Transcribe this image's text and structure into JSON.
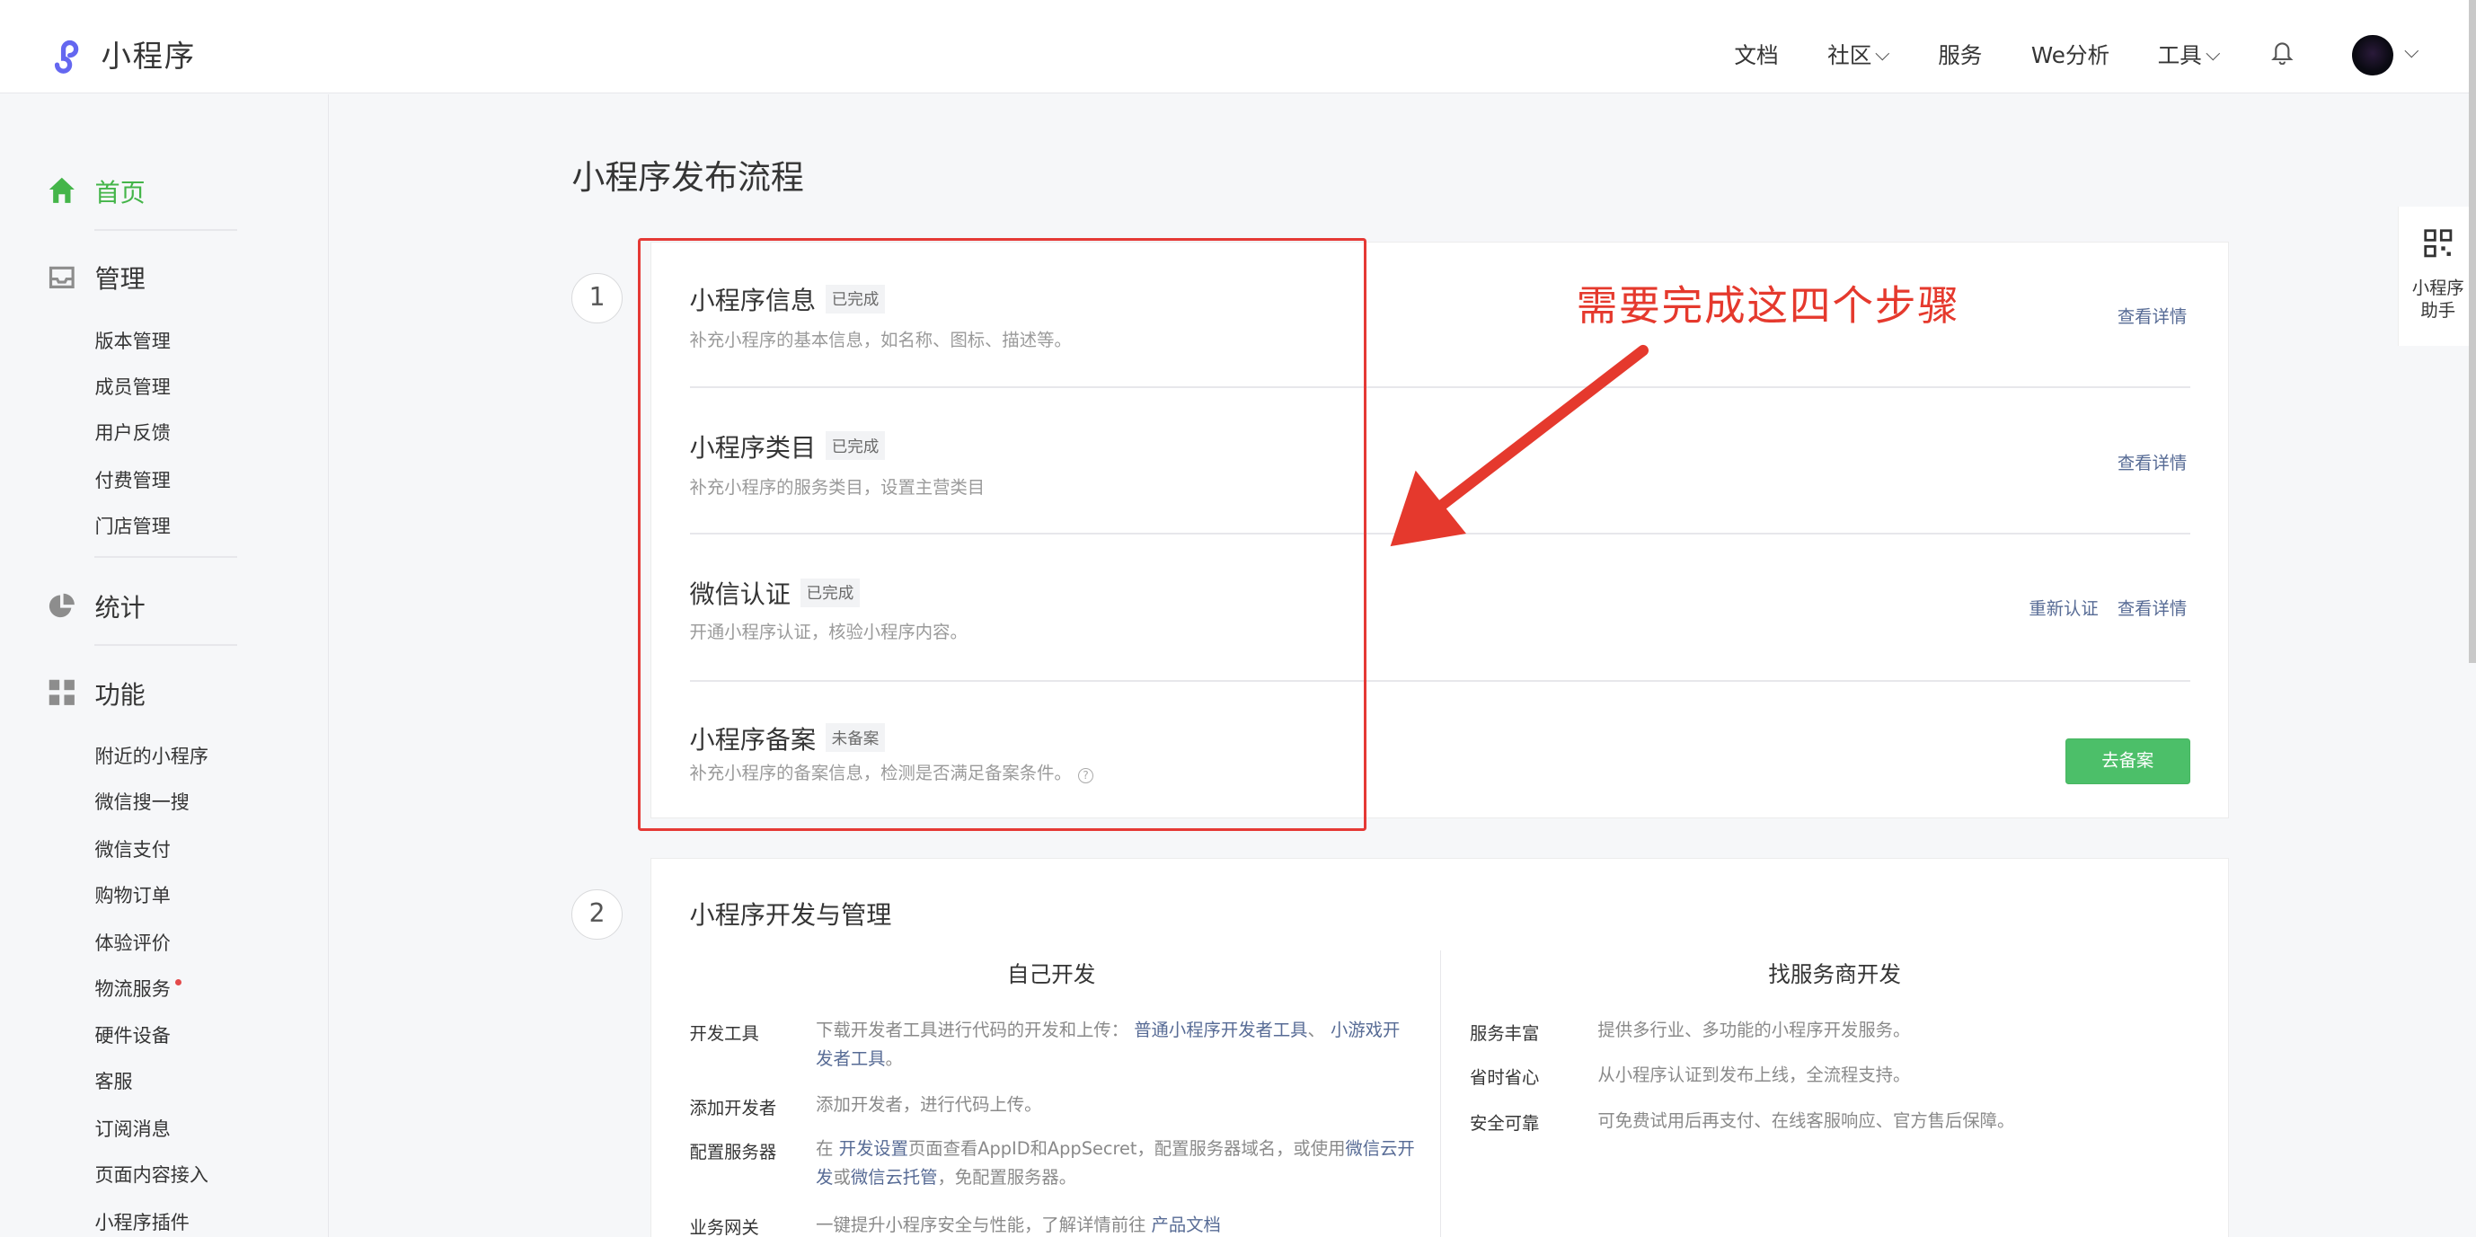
{
  "header": {
    "app_title": "小程序",
    "nav": [
      "文档",
      "社区",
      "服务",
      "We分析",
      "工具"
    ]
  },
  "sidebar": {
    "home": "首页",
    "manage": "管理",
    "manage_items": [
      "版本管理",
      "成员管理",
      "用户反馈",
      "付费管理",
      "门店管理"
    ],
    "stats": "统计",
    "features": "功能",
    "feature_items": [
      "附近的小程序",
      "微信搜一搜",
      "微信支付",
      "购物订单",
      "体验评价",
      "物流服务",
      "硬件设备",
      "客服",
      "订阅消息",
      "页面内容接入",
      "小程序插件"
    ]
  },
  "main": {
    "page_title": "小程序发布流程",
    "step1": {
      "num": "1",
      "rows": [
        {
          "title": "小程序信息",
          "badge": "已完成",
          "desc": "补充小程序的基本信息，如名称、图标、描述等。",
          "link": "查看详情"
        },
        {
          "title": "小程序类目",
          "badge": "已完成",
          "desc": "补充小程序的服务类目，设置主营类目",
          "link": "查看详情"
        },
        {
          "title": "微信认证",
          "badge": "已完成",
          "desc": "开通小程序认证，核验小程序内容。",
          "link": "查看详情",
          "link2": "重新认证"
        },
        {
          "title": "小程序备案",
          "badge": "未备案",
          "desc": "补充小程序的备案信息，检测是否满足备案条件。",
          "button": "去备案"
        }
      ]
    },
    "step2": {
      "num": "2",
      "title": "小程序开发与管理",
      "self_dev": {
        "heading": "自己开发",
        "items": [
          {
            "label": "开发工具",
            "text_a": "下载开发者工具进行代码的开发和上传：",
            "link_a": "普通小程序开发者工具",
            "sep": "、",
            "link_b": "小游戏开发者工具",
            "text_b": "。"
          },
          {
            "label": "添加开发者",
            "text_a": "添加开发者，进行代码上传。"
          },
          {
            "label": "配置服务器",
            "text_a": "在 ",
            "link_a": "开发设置",
            "text_b": "页面查看AppID和AppSecret，配置服务器域名，或使用",
            "link_b": "微信云开发",
            "text_c": "或",
            "link_c": "微信云托管",
            "text_d": "，免配置服务器。"
          },
          {
            "label": "业务网关",
            "text_a": "一键提升小程序安全与性能，了解详情前往 ",
            "link_a": "产品文档"
          }
        ]
      },
      "provider_dev": {
        "heading": "找服务商开发",
        "items": [
          {
            "label": "服务丰富",
            "text": "提供多行业、多功能的小程序开发服务。"
          },
          {
            "label": "省时省心",
            "text": "从小程序认证到发布上线，全流程支持。"
          },
          {
            "label": "安全可靠",
            "text": "可免费试用后再支付、在线客服响应、官方售后保障。"
          }
        ]
      }
    }
  },
  "annotation": "需要完成这四个步骤",
  "helper": {
    "line1": "小程序",
    "line2": "助手"
  },
  "colors": {
    "accent_green": "#4cbf69",
    "link_blue": "#576b95",
    "annotation_red": "#e5392d"
  }
}
